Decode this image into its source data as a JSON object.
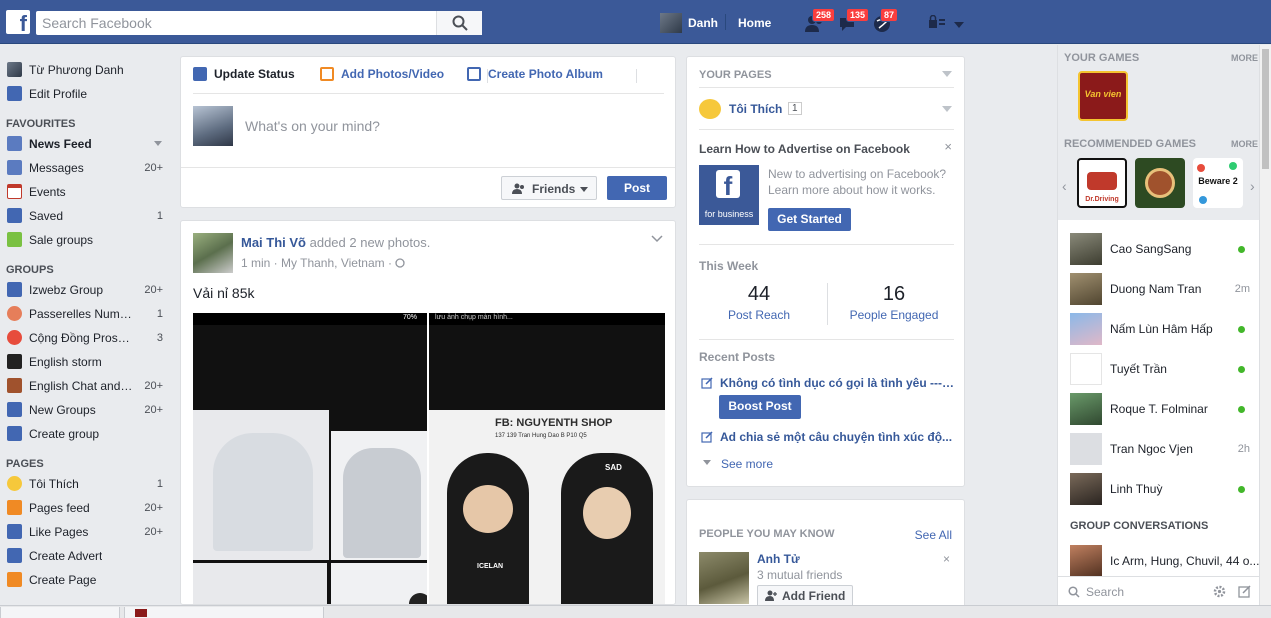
{
  "header": {
    "search_placeholder": "Search Facebook",
    "user_name": "Danh",
    "home_label": "Home",
    "friend_requests_count": "258",
    "messages_count": "135",
    "notifications_count": "87"
  },
  "sidebar": {
    "profile": [
      {
        "label": "Từ Phương Danh",
        "icon": "profile-photo-icon"
      },
      {
        "label": "Edit Profile",
        "icon": "pencil-icon"
      }
    ],
    "favourites_header": "FAVOURITES",
    "favourites": [
      {
        "label": "News Feed",
        "count": "",
        "icon": "news-feed-icon"
      },
      {
        "label": "Messages",
        "count": "20+",
        "icon": "messages-icon"
      },
      {
        "label": "Events",
        "count": "",
        "icon": "calendar-icon"
      },
      {
        "label": "Saved",
        "count": "1",
        "icon": "bookmark-icon"
      },
      {
        "label": "Sale groups",
        "count": "",
        "icon": "price-tag-icon"
      }
    ],
    "groups_header": "GROUPS",
    "groups": [
      {
        "label": "Izwebz Group",
        "count": "20+"
      },
      {
        "label": "Passerelles Numéri...",
        "count": "1"
      },
      {
        "label": "Cộng Đồng Prosho...",
        "count": "3"
      },
      {
        "label": "English storm",
        "count": ""
      },
      {
        "label": "English Chat and ...",
        "count": "20+"
      },
      {
        "label": "New Groups",
        "count": "20+"
      },
      {
        "label": "Create group",
        "count": ""
      }
    ],
    "pages_header": "PAGES",
    "pages": [
      {
        "label": "Tôi Thích",
        "count": "1"
      },
      {
        "label": "Pages feed",
        "count": "20+"
      },
      {
        "label": "Like Pages",
        "count": "20+"
      },
      {
        "label": "Create Advert",
        "count": ""
      },
      {
        "label": "Create Page",
        "count": ""
      }
    ]
  },
  "composer": {
    "tab_update_status": "Update Status",
    "tab_add_photos": "Add Photos/Video",
    "tab_create_album": "Create Photo Album",
    "placeholder": "What's on your mind?",
    "audience_label": "Friends",
    "post_label": "Post"
  },
  "story": {
    "author": "Mai Thi Võ",
    "action": " added 2 new photos.",
    "meta": "1 min · My Thanh, Vietnam ·",
    "text": "Vải nỉ 85k",
    "photo1_status": "70%",
    "photo2_caption": "lưu ảnh chụp màn hình...",
    "shop_name": "FB: NGUYENTH SHOP",
    "shop_address": "137 139 Tran Hung Dao B P10 Q5",
    "cap_text": "SAD",
    "jacket_text": "ICELAN"
  },
  "right": {
    "your_pages": "YOUR PAGES",
    "page_name": "Tôi Thích",
    "page_count": "1",
    "advertise_title": "Learn How to Advertise on Facebook",
    "advertise_desc": "New to advertising on Facebook? Learn more about how it works.",
    "fb_caption": "for business",
    "get_started": "Get Started",
    "this_week": "This Week",
    "post_reach_value": "44",
    "post_reach_label": "Post Reach",
    "engaged_value": "16",
    "engaged_label": "People Engaged",
    "recent_posts": "Recent Posts",
    "recent_post_1": "Không có tình dục có gọi là tình yêu ----...",
    "boost_post": "Boost Post",
    "recent_post_2": "Ad chia sẻ một câu chuyện tình xúc độ...",
    "see_more": "See more",
    "pymk_title": "PEOPLE YOU MAY KNOW",
    "pymk_see_all": "See All",
    "pymk_name": "Anh Tử",
    "pymk_mutual": "3 mutual friends",
    "add_friend": "Add Friend"
  },
  "chat": {
    "your_games": "YOUR GAMES",
    "more": "MORE",
    "recommended_games": "RECOMMENDED GAMES",
    "game_1_label": "Van vien",
    "game_2_label": "Dr.Driving",
    "game_4_label": "Beware 2",
    "contacts": [
      {
        "name": "Cao SangSang",
        "status": "online",
        "time": ""
      },
      {
        "name": "Duong Nam Tran",
        "status": "idle",
        "time": "2m"
      },
      {
        "name": "Nấm Lùn Hâm Hấp",
        "status": "online",
        "time": ""
      },
      {
        "name": "Tuyết Trần",
        "status": "online",
        "time": ""
      },
      {
        "name": "Roque T. Folminar",
        "status": "online",
        "time": ""
      },
      {
        "name": "Tran Ngoc Vjen",
        "status": "idle",
        "time": "2h"
      },
      {
        "name": "Linh Thuỳ",
        "status": "online",
        "time": ""
      }
    ],
    "group_conversations": "GROUP CONVERSATIONS",
    "group_convo_1": "Ic Arm, Hung, Chuvil, 44 o...",
    "search_placeholder": "Search"
  }
}
